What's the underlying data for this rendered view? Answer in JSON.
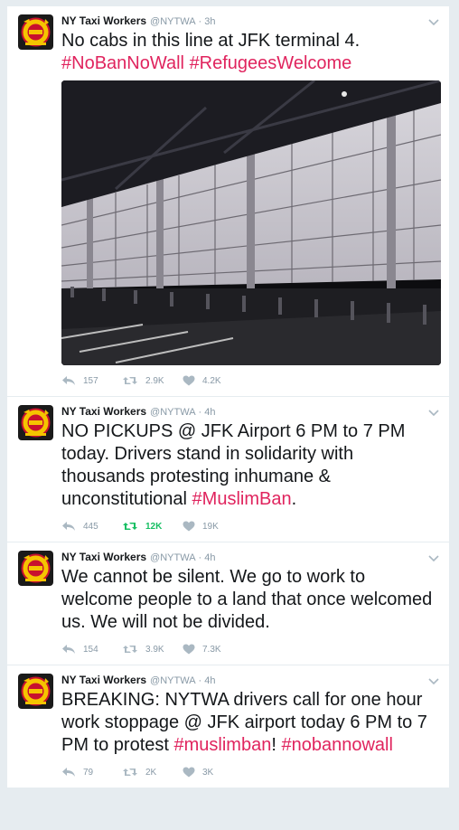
{
  "tweets": [
    {
      "name": "NY Taxi Workers",
      "handle": "@NYTWA",
      "time": "3h",
      "text": [
        {
          "t": "No cabs in this line at JFK terminal 4. ",
          "tag": false
        },
        {
          "t": "#NoBanNoWall",
          "tag": true
        },
        {
          "t": " ",
          "tag": false
        },
        {
          "t": "#RefugeesWelcome",
          "tag": true
        }
      ],
      "has_media": true,
      "replies": "157",
      "retweets": "2.9K",
      "likes": "4.2K",
      "retweeted": false
    },
    {
      "name": "NY Taxi Workers",
      "handle": "@NYTWA",
      "time": "4h",
      "text": [
        {
          "t": "NO PICKUPS @ JFK Airport 6 PM to 7 PM today. Drivers stand in solidarity with thousands protesting inhumane & unconstitutional ",
          "tag": false
        },
        {
          "t": "#MuslimBan",
          "tag": true
        },
        {
          "t": ".",
          "tag": false
        }
      ],
      "has_media": false,
      "replies": "445",
      "retweets": "12K",
      "likes": "19K",
      "retweeted": true
    },
    {
      "name": "NY Taxi Workers",
      "handle": "@NYTWA",
      "time": "4h",
      "text": [
        {
          "t": "We cannot be silent. We go to work to welcome people to a land that once welcomed us. We will not be divided.",
          "tag": false
        }
      ],
      "has_media": false,
      "replies": "154",
      "retweets": "3.9K",
      "likes": "7.3K",
      "retweeted": false
    },
    {
      "name": "NY Taxi Workers",
      "handle": "@NYTWA",
      "time": "4h",
      "text": [
        {
          "t": "BREAKING: NYTWA drivers call for one hour work stoppage @ JFK airport today 6 PM to 7 PM to protest ",
          "tag": false
        },
        {
          "t": "#muslimban",
          "tag": true
        },
        {
          "t": "! ",
          "tag": false
        },
        {
          "t": "#nobannowall",
          "tag": true
        }
      ],
      "has_media": false,
      "replies": "79",
      "retweets": "2K",
      "likes": "3K",
      "retweeted": false
    }
  ],
  "separator": "·",
  "icons": {
    "reply": "reply-icon",
    "retweet": "retweet-icon",
    "like": "heart-icon",
    "caret": "chevron-down-icon",
    "avatar": "nytwa-logo"
  },
  "colors": {
    "hashtag": "#e0245e",
    "retweeted": "#17bf63",
    "meta": "#8899a6"
  }
}
